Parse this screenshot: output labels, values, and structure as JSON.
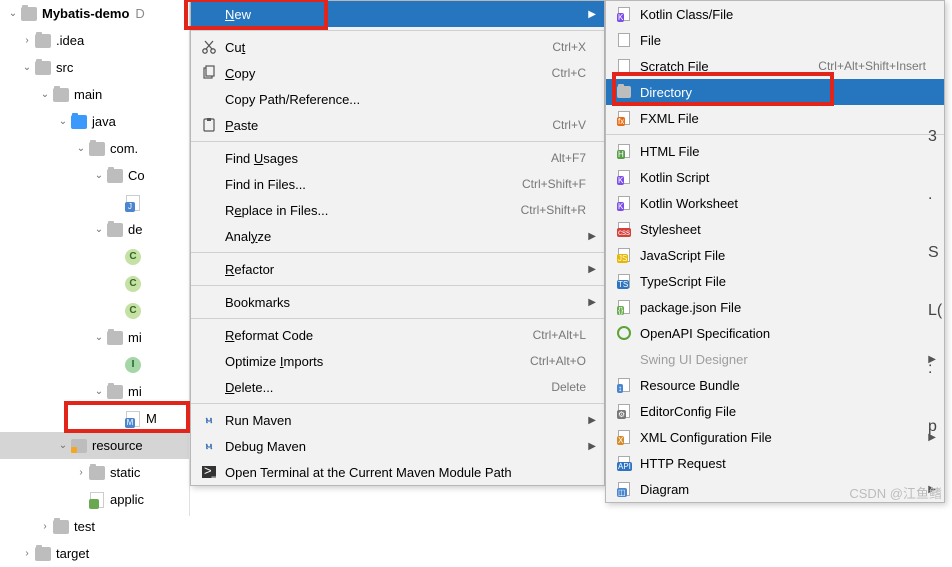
{
  "tree": {
    "root": "Mybatis-demo",
    "root_hint": "D",
    "items": [
      {
        "label": ".idea",
        "indent": 1,
        "icon": "folder-grey",
        "chev": "›"
      },
      {
        "label": "src",
        "indent": 1,
        "icon": "folder-grey",
        "chev": "⌄"
      },
      {
        "label": "main",
        "indent": 2,
        "icon": "folder-grey",
        "chev": "⌄"
      },
      {
        "label": "java",
        "indent": 3,
        "icon": "folder-blue",
        "chev": "⌄"
      },
      {
        "label": "com.",
        "indent": 4,
        "icon": "folder-grey",
        "chev": "⌄"
      },
      {
        "label": "Co",
        "indent": 5,
        "icon": "folder-grey",
        "chev": "⌄"
      },
      {
        "label": "",
        "indent": 6,
        "icon": "jfile",
        "chev": ""
      },
      {
        "label": "de",
        "indent": 5,
        "icon": "folder-grey",
        "chev": "⌄"
      },
      {
        "label": "",
        "indent": 6,
        "icon": "circle-c",
        "chev": ""
      },
      {
        "label": "",
        "indent": 6,
        "icon": "circle-c",
        "chev": ""
      },
      {
        "label": "",
        "indent": 6,
        "icon": "circle-c",
        "chev": ""
      },
      {
        "label": "mi",
        "indent": 5,
        "icon": "folder-grey",
        "chev": "⌄"
      },
      {
        "label": "",
        "indent": 6,
        "icon": "circle-i",
        "chev": ""
      },
      {
        "label": "mi",
        "indent": 5,
        "icon": "folder-grey",
        "chev": "⌄"
      },
      {
        "label": "M",
        "indent": 6,
        "icon": "mfile",
        "chev": ""
      },
      {
        "label": "resource",
        "indent": 3,
        "icon": "folder-res",
        "chev": "⌄",
        "selected": true
      },
      {
        "label": "static",
        "indent": 4,
        "icon": "folder-grey",
        "chev": "›"
      },
      {
        "label": "applic",
        "indent": 4,
        "icon": "appfile",
        "chev": ""
      },
      {
        "label": "test",
        "indent": 2,
        "icon": "folder-grey",
        "chev": "›"
      },
      {
        "label": "target",
        "indent": 1,
        "icon": "folder-grey",
        "chev": "›"
      }
    ]
  },
  "menu1": [
    {
      "type": "item",
      "label": "New",
      "arrow": true,
      "selected": true,
      "ul": 0,
      "icon": ""
    },
    {
      "type": "sep"
    },
    {
      "type": "item",
      "label": "Cut",
      "short": "Ctrl+X",
      "ul": 2,
      "icon": "cut"
    },
    {
      "type": "item",
      "label": "Copy",
      "short": "Ctrl+C",
      "ul": 0,
      "icon": "copy"
    },
    {
      "type": "item",
      "label": "Copy Path/Reference...",
      "icon": ""
    },
    {
      "type": "item",
      "label": "Paste",
      "short": "Ctrl+V",
      "ul": 0,
      "icon": "paste"
    },
    {
      "type": "sep"
    },
    {
      "type": "item",
      "label": "Find Usages",
      "short": "Alt+F7",
      "ul": 5,
      "icon": ""
    },
    {
      "type": "item",
      "label": "Find in Files...",
      "short": "Ctrl+Shift+F",
      "icon": ""
    },
    {
      "type": "item",
      "label": "Replace in Files...",
      "short": "Ctrl+Shift+R",
      "ul": 1,
      "icon": ""
    },
    {
      "type": "item",
      "label": "Analyze",
      "arrow": true,
      "ul": 4,
      "icon": ""
    },
    {
      "type": "sep"
    },
    {
      "type": "item",
      "label": "Refactor",
      "arrow": true,
      "ul": 0,
      "icon": ""
    },
    {
      "type": "sep"
    },
    {
      "type": "item",
      "label": "Bookmarks",
      "arrow": true,
      "icon": ""
    },
    {
      "type": "sep"
    },
    {
      "type": "item",
      "label": "Reformat Code",
      "short": "Ctrl+Alt+L",
      "ul": 0,
      "icon": ""
    },
    {
      "type": "item",
      "label": "Optimize Imports",
      "short": "Ctrl+Alt+O",
      "ul": 9,
      "icon": ""
    },
    {
      "type": "item",
      "label": "Delete...",
      "short": "Delete",
      "ul": 0,
      "icon": ""
    },
    {
      "type": "sep"
    },
    {
      "type": "item",
      "label": "Run Maven",
      "arrow": true,
      "icon": "maven"
    },
    {
      "type": "item",
      "label": "Debug Maven",
      "arrow": true,
      "icon": "maven-dbg"
    },
    {
      "type": "item",
      "label": "Open Terminal at the Current Maven Module Path",
      "icon": "terminal"
    }
  ],
  "menu2": [
    {
      "type": "item",
      "label": "Kotlin Class/File",
      "icon": "kotlin"
    },
    {
      "type": "item",
      "label": "File",
      "icon": "file"
    },
    {
      "type": "item",
      "label": "Scratch File",
      "short": "Ctrl+Alt+Shift+Insert",
      "icon": "file"
    },
    {
      "type": "item",
      "label": "Directory",
      "selected": true,
      "icon": "folder"
    },
    {
      "type": "item",
      "label": "FXML File",
      "icon": "fxml"
    },
    {
      "type": "sep"
    },
    {
      "type": "item",
      "label": "HTML File",
      "icon": "html"
    },
    {
      "type": "item",
      "label": "Kotlin Script",
      "icon": "kotlin"
    },
    {
      "type": "item",
      "label": "Kotlin Worksheet",
      "icon": "kotlin"
    },
    {
      "type": "item",
      "label": "Stylesheet",
      "icon": "css"
    },
    {
      "type": "item",
      "label": "JavaScript File",
      "icon": "js"
    },
    {
      "type": "item",
      "label": "TypeScript File",
      "icon": "ts"
    },
    {
      "type": "item",
      "label": "package.json File",
      "icon": "pkg"
    },
    {
      "type": "item",
      "label": "OpenAPI Specification",
      "icon": "api"
    },
    {
      "type": "item",
      "label": "Swing UI Designer",
      "arrow": true,
      "disabled": true,
      "icon": ""
    },
    {
      "type": "item",
      "label": "Resource Bundle",
      "icon": "rb"
    },
    {
      "type": "item",
      "label": "EditorConfig File",
      "icon": "ec"
    },
    {
      "type": "item",
      "label": "XML Configuration File",
      "arrow": true,
      "icon": "xml"
    },
    {
      "type": "item",
      "label": "HTTP Request",
      "icon": "http"
    },
    {
      "type": "item",
      "label": "Diagram",
      "arrow": true,
      "icon": "diag"
    }
  ],
  "edge_chars": [
    "3",
    ".",
    "S",
    "L(",
    ":",
    "p"
  ],
  "watermark": "CSDN @江鱼鳍"
}
